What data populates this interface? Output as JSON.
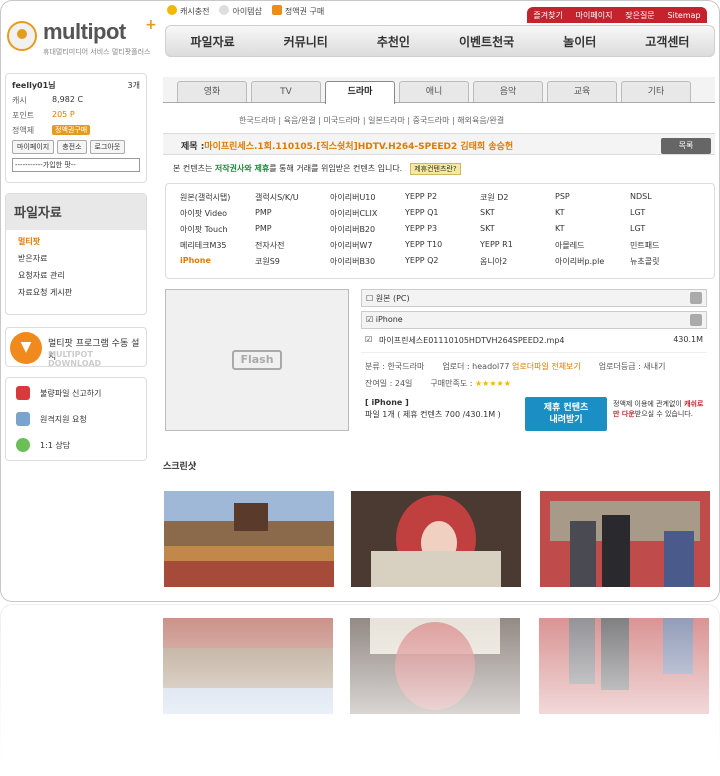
{
  "logo": {
    "name": "multipot",
    "plus": "+",
    "tagline": "휴대멀티미디어 서비스 멀티팟플러스"
  },
  "quick_links": [
    "캐시충전",
    "아이템샵",
    "정액권 구매"
  ],
  "top_links": [
    "즐겨찾기",
    "마이페이지",
    "잦은질문",
    "Sitemap"
  ],
  "gnb": [
    "파일자료",
    "커뮤니티",
    "추천인",
    "이벤트천국",
    "놀이터",
    "고객센터"
  ],
  "user": {
    "id": "feelly01님",
    "messages": "3개",
    "cash_label": "캐시",
    "cash": "8,982 C",
    "point_label": "포인트",
    "point": "205 P",
    "plan_label": "정액제",
    "plan_button": "정액권구매",
    "buttons": [
      "마이페이지",
      "충전소",
      "로그아웃"
    ],
    "select": "-----------가입한 팟--"
  },
  "file_menu": {
    "title": "파일자료",
    "items": [
      "멀티팟",
      "받은자료",
      "요청자료 관리",
      "자료요청 게시판"
    ]
  },
  "install": {
    "title": "멀티팟 프로그램 수동 설치",
    "sub": "MULTIPOT DOWNLOAD"
  },
  "support": [
    "불량파일 신고하기",
    "원격지원 요청",
    "1:1 상담"
  ],
  "tabs": [
    "영화",
    "TV",
    "드라마",
    "애니",
    "음악",
    "교육",
    "기타"
  ],
  "sub_categories": "한국드라마 | 육음/완결 | 미국드라마 | 일본드라마 | 중국드라마 | 해외육음/완결",
  "title": {
    "prefix": "제목 :",
    "text": "마이프린세스.1회.110105.[직스쉿처]HDTV.H264-SPEED2 김태희 송승헌"
  },
  "list_button": "목록",
  "notice": {
    "pre": "본 컨텐츠는 ",
    "highlight": "저작권사와 제휴",
    "post": "를 통해 거래를 위임받은 컨텐츠 입니다.",
    "badge": "제휴컨텐츠란?"
  },
  "devices": [
    "원본(갤럭시탭)",
    "갤럭시S/K/U",
    "아이리버U10",
    "YEPP P2",
    "코원 D2",
    "PSP",
    "NDSL",
    "아이팟 Video",
    "PMP",
    "아이리버CLIX",
    "YEPP Q1",
    "SKT",
    "KT",
    "LGT",
    "아이팟 Touch",
    "PMP",
    "아이리버B20",
    "YEPP P3",
    "SKT",
    "KT",
    "LGT",
    "메리테크M35",
    "전자사전",
    "아이리버W7",
    "YEPP T10",
    "YEPP R1",
    "아몰레드",
    "민트패드",
    "iPhone",
    "코원S9",
    "아이리버B30",
    "YEPP Q2",
    "옴니아2",
    "아이리버p.ple",
    "뉴초콜릿"
  ],
  "flash_label": "Flash",
  "files": {
    "original": "원본 (PC)",
    "iphone": "iPhone",
    "file_name": "마이프린세스E01110105HDTVH264SPEED2.mp4",
    "file_size": "430.1M",
    "category": "분류 : 한국드라마",
    "uploader": "업로더 : headol77",
    "uploader_link": "업로더파일 전체보기",
    "grade": "업로더등급 : 새내기",
    "remaining": "잔여일 : 24일",
    "rating_label": "구매만족도 :",
    "rating": "★★★★★",
    "buy_device": "[ iPhone ]",
    "buy_text": "파일 1개 ( 제휴 컨텐츠 700",
    "buy_size": "/430.1M )",
    "buy_button_l1": "제휴 컨텐츠",
    "buy_button_l2": "내려받기",
    "warn_pre": "정액제 이용에 관계없이 ",
    "warn_b": "캐쉬로만 다운",
    "warn_post": "받으실 수 있습니다."
  },
  "screenshot_label": "스크린샷",
  "colors": {
    "accent": "#e07a00",
    "brand_red": "#c4232e",
    "download_blue": "#1b8fc4"
  }
}
